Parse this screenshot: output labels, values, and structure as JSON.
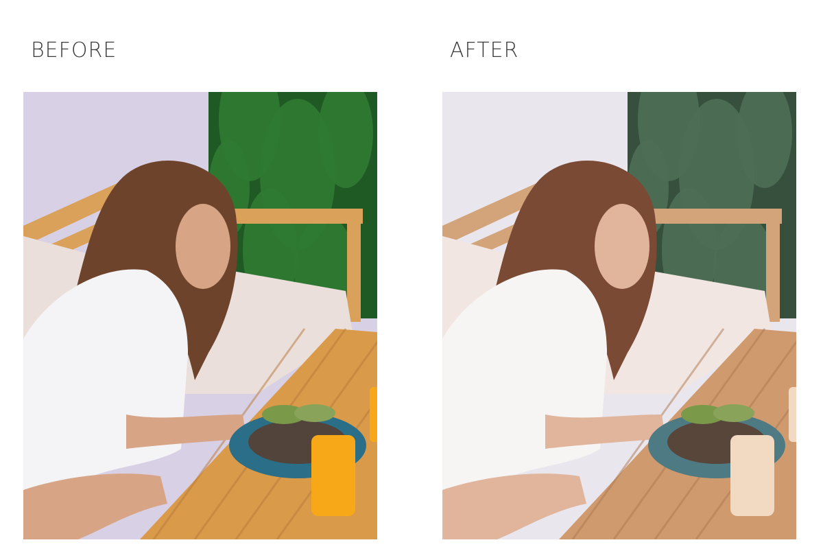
{
  "labels": {
    "before": "BEFORE",
    "after": "AFTER"
  },
  "photos": {
    "before": {
      "wall": "#d8d0e4",
      "plants": "#2f7a33",
      "plants_dark": "#1f5a25",
      "wood": "#d9a15a",
      "table": "#d99a4a",
      "table_dark": "#b9793a",
      "cushion": "#eadfdb",
      "shirt": "#f4f4f6",
      "skin": "#d7a585",
      "hair": "#6e432b",
      "plate": "#2a6e88",
      "juice": "#f7a818"
    },
    "after": {
      "wall": "#e9e6ee",
      "plants": "#4e6f55",
      "plants_dark": "#36503d",
      "wood": "#d3a47a",
      "table": "#cf9a6d",
      "table_dark": "#ad7a54",
      "cushion": "#f2e6e2",
      "shirt": "#f7f5f4",
      "skin": "#e0b59b",
      "hair": "#7a4a34",
      "plate": "#4e7a84",
      "juice": "#f1d9c2"
    }
  }
}
